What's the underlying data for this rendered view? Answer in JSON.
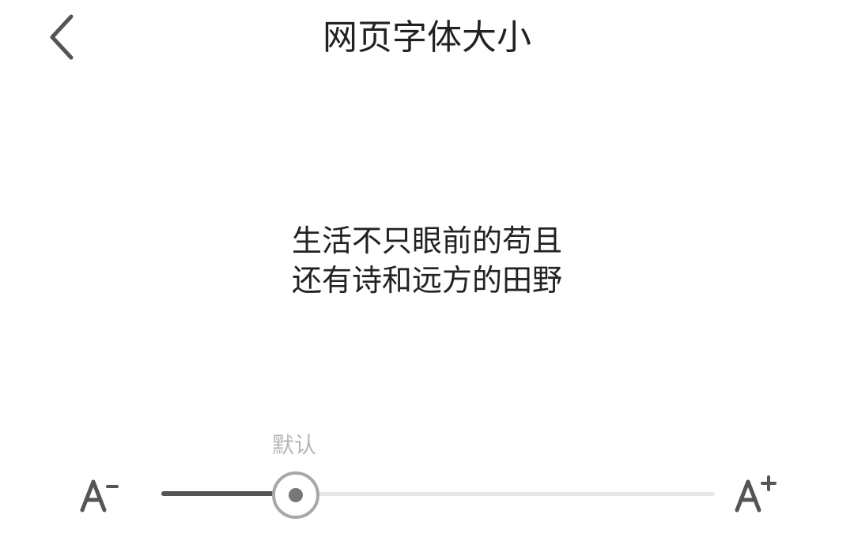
{
  "header": {
    "title": "网页字体大小",
    "back_icon": "chevron-left-icon"
  },
  "preview": {
    "line1": "生活不只眼前的苟且",
    "line2": "还有诗和远方的田野"
  },
  "font_size": {
    "default_label": "默认",
    "decrease_label": "A-",
    "increase_label": "A+",
    "level_fraction": 0.24,
    "colors": {
      "fill": "#555555",
      "track": "#e6e6e6",
      "thumb_ring": "#a8a8a8",
      "label": "#b5b5b5"
    }
  }
}
